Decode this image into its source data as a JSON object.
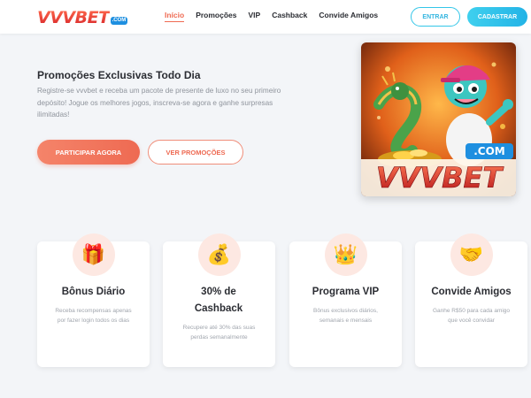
{
  "header": {
    "logo_text": "VVVBET",
    "logo_badge": ".COM",
    "nav": [
      {
        "label": "Início",
        "active": true
      },
      {
        "label": "Promoções",
        "active": false
      },
      {
        "label": "VIP",
        "active": false
      },
      {
        "label": "Cashback",
        "active": false
      },
      {
        "label": "Convide Amigos",
        "active": false
      }
    ],
    "login_label": "ENTRAR",
    "signup_label": "CADASTRAR"
  },
  "hero": {
    "title": "Promoções Exclusivas Todo Dia",
    "description": "Registre-se vvvbet e receba um pacote de presente de luxo no seu primeiro depósito! Jogue os melhores jogos, inscreva-se agora e ganhe surpresas ilimitadas!",
    "primary_button": "PARTICIPAR AGORA",
    "secondary_button": "VER PROMOÇÕES",
    "banner": {
      "brand_text": "VVVBET",
      "domain_text": ".COM"
    }
  },
  "features": [
    {
      "icon": "gift-icon",
      "emoji": "🎁",
      "title": "Bônus Diário",
      "description": "Receba recompensas apenas por fazer login todos os dias"
    },
    {
      "icon": "money-bag-icon",
      "emoji": "💰",
      "title": "30% de Cashback",
      "description": "Recupere até 30% das suas perdas semanalmente"
    },
    {
      "icon": "crown-icon",
      "emoji": "👑",
      "title": "Programa VIP",
      "description": "Bônus exclusivos diários, semanais e mensais"
    },
    {
      "icon": "handshake-icon",
      "emoji": "🤝",
      "title": "Convide Amigos",
      "description": "Ganhe R$50 para cada amigo que você convidar"
    }
  ],
  "colors": {
    "accent": "#ee6a52",
    "secondary_accent": "#2bbbe6",
    "background": "#f3f5f8"
  }
}
